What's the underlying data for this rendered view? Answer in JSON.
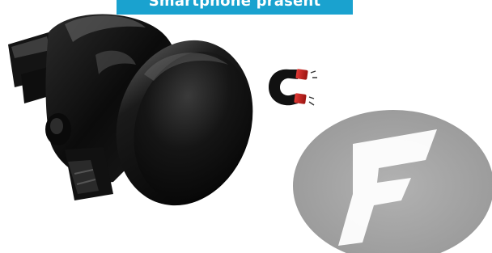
{
  "banner": {
    "text": "Smartphone präsent",
    "color": "#1aa2cf"
  },
  "items": {
    "holder": "car-vent-magnetic-holder",
    "magnet": "horseshoe-magnet-icon",
    "plate": "metal-plate-with-f-logo"
  }
}
